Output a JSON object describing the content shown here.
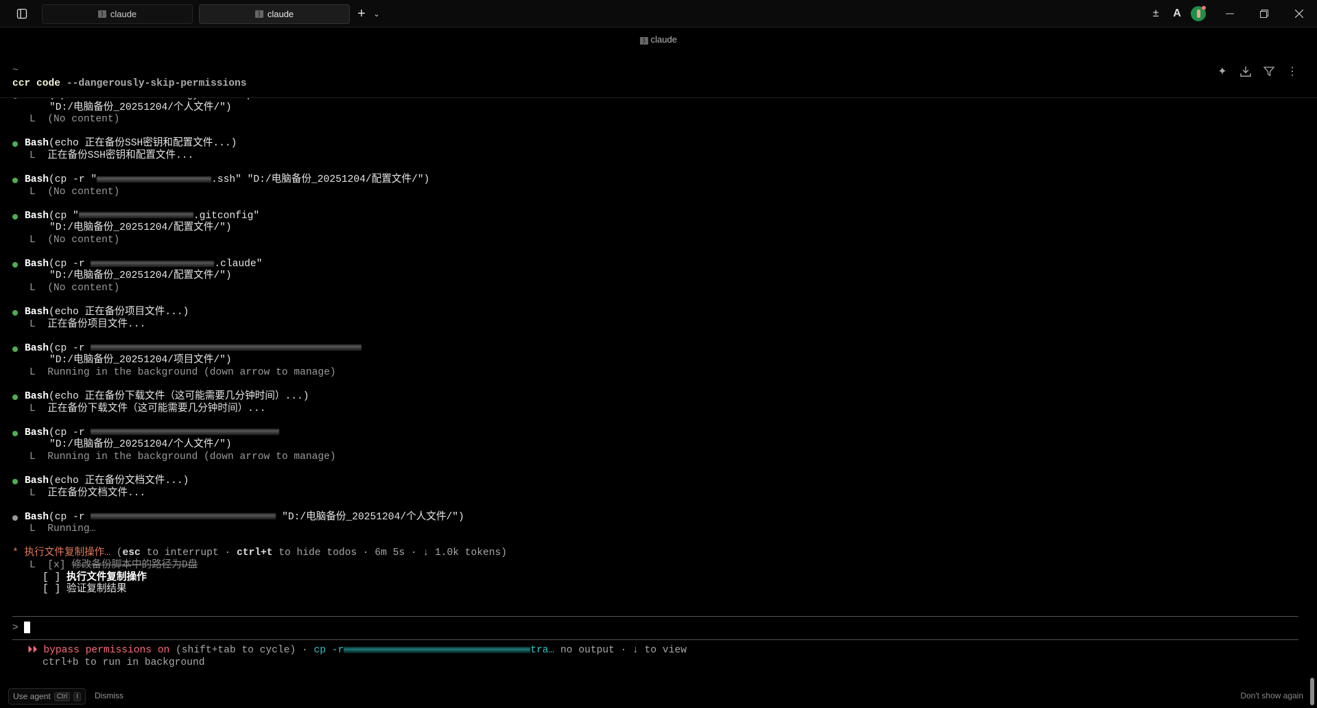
{
  "titlebar": {
    "tabs": [
      {
        "label": "claude",
        "active": false
      },
      {
        "label": "claude",
        "active": true
      }
    ],
    "new_tab": "+",
    "tab_dropdown": "⌄"
  },
  "pane": {
    "title": "claude",
    "tilde": "~",
    "command_bin": "ccr code",
    "command_args": " --dangerously-skip-permissions"
  },
  "log": [
    {
      "status": "done",
      "tool": "Bash",
      "args": [
        {
          "t": "(cp -r \"/c/Users/zhuhongyu/Desktop"
        }
      ],
      "cont": "\"D:/电脑备份_20251204/个人文件/\")",
      "result": "(No content)",
      "result_style": "gray"
    },
    {
      "status": "done",
      "tool": "Bash",
      "args": [
        {
          "t": "(echo 正在备份SSH密钥和配置文件...)"
        }
      ],
      "result": "正在备份SSH密钥和配置文件...",
      "result_style": "plain"
    },
    {
      "status": "done",
      "tool": "Bash",
      "args": [
        {
          "t": "(cp -r \""
        },
        {
          "r": "r19"
        },
        {
          "t": ".ssh\" \"D:/电脑备份_20251204/配置文件/\")"
        }
      ],
      "result": "(No content)",
      "result_style": "gray"
    },
    {
      "status": "done",
      "tool": "Bash",
      "args": [
        {
          "t": "(cp \""
        },
        {
          "r": "r19"
        },
        {
          "t": ".gitconfig\""
        }
      ],
      "cont": "\"D:/电脑备份_20251204/配置文件/\")",
      "result": "(No content)",
      "result_style": "gray"
    },
    {
      "status": "done",
      "tool": "Bash",
      "args": [
        {
          "t": "(cp -r "
        },
        {
          "r": "r20"
        },
        {
          "t": ".claude\""
        }
      ],
      "cont": "\"D:/电脑备份_20251204/配置文件/\")",
      "result": "(No content)",
      "result_style": "gray"
    },
    {
      "status": "done",
      "tool": "Bash",
      "args": [
        {
          "t": "(echo 正在备份项目文件...)"
        }
      ],
      "result": "正在备份项目文件...",
      "result_style": "plain"
    },
    {
      "status": "done",
      "tool": "Bash",
      "args": [
        {
          "t": "(cp -r "
        },
        {
          "r": "r45"
        }
      ],
      "cont": "\"D:/电脑备份_20251204/项目文件/\")",
      "result": "Running in the background (down arrow to manage)",
      "result_style": "gray"
    },
    {
      "status": "done",
      "tool": "Bash",
      "args": [
        {
          "t": "(echo 正在备份下载文件（这可能需要几分钟时间）...)"
        }
      ],
      "result": "正在备份下载文件（这可能需要几分钟时间）...",
      "result_style": "plain"
    },
    {
      "status": "done",
      "tool": "Bash",
      "args": [
        {
          "t": "(cp -r "
        },
        {
          "r": "r31"
        }
      ],
      "cont": "\"D:/电脑备份_20251204/个人文件/\")",
      "result": "Running in the background (down arrow to manage)",
      "result_style": "gray"
    },
    {
      "status": "done",
      "tool": "Bash",
      "args": [
        {
          "t": "(echo 正在备份文档文件...)"
        }
      ],
      "result": "正在备份文档文件...",
      "result_style": "plain"
    },
    {
      "status": "running",
      "tool": "Bash",
      "args": [
        {
          "t": "(cp -r "
        },
        {
          "r": "r30"
        },
        {
          "t": " \"D:/电脑备份_20251204/个人文件/\")"
        }
      ],
      "result": "Running…",
      "result_style": "gray"
    }
  ],
  "todos": {
    "spinner": "* ",
    "current": "执行文件复制操作…",
    "open": " (",
    "esc": "esc",
    "esc_text": " to interrupt · ",
    "ctrl_t": "ctrl+t",
    "ctrl_t_text": " to hide todos · 6m 5s · ↓ 1.0k tokens)",
    "items": [
      {
        "box": "[x]",
        "label": "修改备份脚本中的路径为D盘",
        "state": "done"
      },
      {
        "box": "[ ]",
        "label": "执行文件复制操作",
        "state": "active"
      },
      {
        "box": "[ ]",
        "label": "验证复制结果",
        "state": "pending"
      }
    ]
  },
  "input": {
    "prompt": ">",
    "value": ""
  },
  "status": {
    "arrows": "⏵⏵ ",
    "mode": "bypass permissions on",
    "cycle": " (shift+tab to cycle) · ",
    "cmd_prefix": "cp -r",
    "cmd_suffix": "tra…",
    "tail": " no output · ↓ to view",
    "line2": "ctrl+b to run in background"
  },
  "agent_bar": {
    "label": "Use agent",
    "key1": "Ctrl",
    "key2": "I",
    "dismiss": "Dismiss",
    "dont_show": "Don't show again"
  }
}
